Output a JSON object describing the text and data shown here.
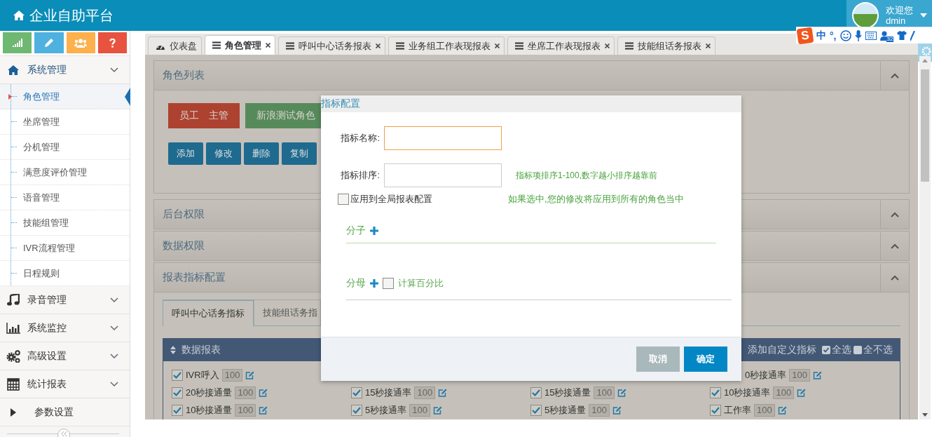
{
  "header": {
    "title": "企业自助平台",
    "greeting": "欢迎您",
    "username": "dmin"
  },
  "ime_toolbar": {
    "logo": "S",
    "mode": "中",
    "punctuation": "°,",
    "badge": "32"
  },
  "shortcuts": [
    {
      "kind": "signal",
      "color": "#6fb872"
    },
    {
      "kind": "pencil",
      "color": "#4fb1df"
    },
    {
      "kind": "users",
      "color": "#fdb04b"
    },
    {
      "kind": "question",
      "color": "#e8533f"
    }
  ],
  "menu": [
    {
      "label": "系统管理",
      "kind": "home",
      "expanded": true,
      "children": [
        {
          "label": "角色管理",
          "selected": true
        },
        {
          "label": "坐席管理",
          "selected": false
        },
        {
          "label": "分机管理",
          "selected": false
        },
        {
          "label": "满意度评价管理",
          "selected": false
        },
        {
          "label": "语音管理",
          "selected": false
        },
        {
          "label": "技能组管理",
          "selected": false
        },
        {
          "label": "IVR流程管理",
          "selected": false
        },
        {
          "label": "日程规则",
          "selected": false
        }
      ]
    },
    {
      "label": "录音管理",
      "kind": "music",
      "expanded": false
    },
    {
      "label": "系统监控",
      "kind": "bars",
      "expanded": false
    },
    {
      "label": "高级设置",
      "kind": "gears",
      "expanded": false
    },
    {
      "label": "统计报表",
      "kind": "grid",
      "expanded": false
    },
    {
      "label": "参数设置",
      "kind": "leaf",
      "expanded": false
    }
  ],
  "tabs": [
    {
      "label": "仪表盘",
      "kind": "dashboard",
      "closable": false,
      "selected": false
    },
    {
      "label": "角色管理",
      "kind": "list",
      "closable": true,
      "selected": true
    },
    {
      "label": "呼叫中心话务报表",
      "kind": "list",
      "closable": true,
      "selected": false
    },
    {
      "label": "业务组工作表现报表",
      "kind": "list",
      "closable": true,
      "selected": false
    },
    {
      "label": "坐席工作表现报表",
      "kind": "list",
      "closable": true,
      "selected": false
    },
    {
      "label": "技能组话务报表",
      "kind": "list",
      "closable": true,
      "selected": false
    }
  ],
  "role_panel": {
    "title": "角色列表",
    "expanded": true,
    "roles": [
      {
        "label": "员工　主管",
        "color": "#ad4231"
      },
      {
        "label": "新浪测试角色",
        "color": "#578a5b"
      }
    ],
    "actions": [
      "添加",
      "修改",
      "删除",
      "复制"
    ]
  },
  "collapsed_panels": [
    {
      "title": "后台权限",
      "expanded": false
    },
    {
      "title": "数据权限",
      "expanded": false
    }
  ],
  "report_panel": {
    "title": "报表指标配置",
    "expanded": true,
    "tabs": [
      {
        "label": "呼叫中心话务指标",
        "selected": true
      },
      {
        "label": "技能组话务指",
        "selected": false
      }
    ],
    "table_title": "数据报表",
    "add_label": "添加自定义指标",
    "select_all": {
      "label": "全选",
      "checked": true
    },
    "select_none": {
      "label": "全不选",
      "checked": false
    },
    "rows": [
      [
        {
          "label": "IVR呼入",
          "value": "100",
          "checked": true
        },
        null,
        null,
        {
          "label": "0秒接通率",
          "value": "100"
        }
      ],
      [
        {
          "label": "20秒接通量",
          "value": "100",
          "checked": true
        },
        {
          "label": "15秒接通率",
          "value": "100",
          "checked": true
        },
        {
          "label": "15秒接通量",
          "value": "100",
          "checked": true
        },
        {
          "label": "10秒接通率",
          "value": "100",
          "checked": true
        }
      ],
      [
        {
          "label": "10秒接通量",
          "value": "100",
          "checked": true
        },
        {
          "label": "5秒接通率",
          "value": "100",
          "checked": true
        },
        {
          "label": "5秒接通量",
          "value": "100",
          "checked": true
        },
        {
          "label": "工作率",
          "value": "100",
          "checked": true
        }
      ]
    ]
  },
  "modal": {
    "title": "指标配置",
    "fields": [
      {
        "label": "指标名称:",
        "focused": true
      },
      {
        "label": "指标排序:",
        "focused": false,
        "hint": "指标项排序1-100,数字越小排序越靠前"
      }
    ],
    "global": {
      "label": "应用到全局报表配置",
      "checked": false,
      "hint": "如果选中,您的修改将应用到所有的角色当中"
    },
    "numerator": "分子",
    "denominator": "分母",
    "percent": {
      "label": "计算百分比",
      "checked": false
    },
    "buttons": [
      {
        "label": "取消",
        "kind": "secondary"
      },
      {
        "label": "确定",
        "kind": "primary"
      }
    ]
  }
}
